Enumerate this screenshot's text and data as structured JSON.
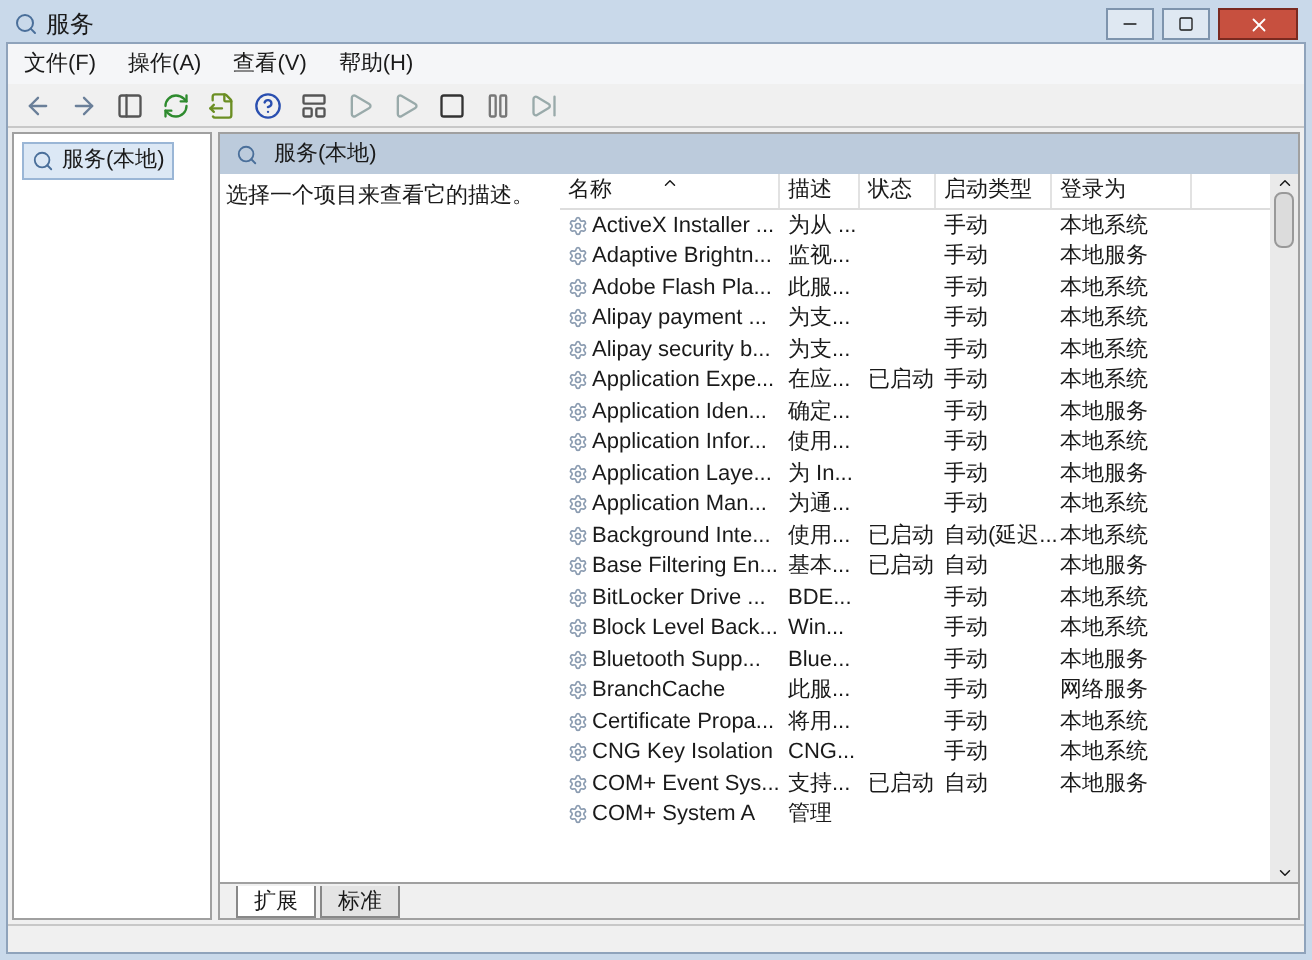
{
  "window": {
    "title": "服务"
  },
  "menu": [
    "文件(F)",
    "操作(A)",
    "查看(V)",
    "帮助(H)"
  ],
  "tree": {
    "items": [
      {
        "label": "服务(本地)",
        "selected": true
      }
    ]
  },
  "panel": {
    "title": "服务(本地)",
    "description": "选择一个项目来查看它的描述。"
  },
  "table": {
    "columns": [
      {
        "label": "名称",
        "sorted": true
      },
      {
        "label": "描述",
        "sorted": false
      },
      {
        "label": "状态",
        "sorted": false
      },
      {
        "label": "启动类型",
        "sorted": false
      },
      {
        "label": "登录为",
        "sorted": false
      }
    ],
    "rows": [
      {
        "name": "ActiveX Installer ...",
        "description": "为从 ...",
        "startup": "手动",
        "logon": "本地系统"
      },
      {
        "name": "Adaptive Brightn...",
        "description": "监视...",
        "startup": "手动",
        "logon": "本地服务"
      },
      {
        "name": "Adobe Flash Pla...",
        "description": "此服...",
        "startup": "手动",
        "logon": "本地系统"
      },
      {
        "name": "Alipay payment ...",
        "description": "为支...",
        "startup": "手动",
        "logon": "本地系统"
      },
      {
        "name": "Alipay security b...",
        "description": "为支...",
        "startup": "手动",
        "logon": "本地系统"
      },
      {
        "name": "Application Expe...",
        "description": "在应...",
        "status": "已启动",
        "startup": "手动",
        "logon": "本地系统"
      },
      {
        "name": "Application Iden...",
        "description": "确定...",
        "startup": "手动",
        "logon": "本地服务"
      },
      {
        "name": "Application Infor...",
        "description": "使用...",
        "startup": "手动",
        "logon": "本地系统"
      },
      {
        "name": "Application Laye...",
        "description": "为 In...",
        "startup": "手动",
        "logon": "本地服务"
      },
      {
        "name": "Application Man...",
        "description": "为通...",
        "startup": "手动",
        "logon": "本地系统"
      },
      {
        "name": "Background Inte...",
        "description": "使用...",
        "status": "已启动",
        "startup": "自动(延迟...",
        "logon": "本地系统"
      },
      {
        "name": "Base Filtering En...",
        "description": "基本...",
        "status": "已启动",
        "startup": "自动",
        "logon": "本地服务"
      },
      {
        "name": "BitLocker Drive ...",
        "description": "BDE...",
        "startup": "手动",
        "logon": "本地系统"
      },
      {
        "name": "Block Level Back...",
        "description": "Win...",
        "startup": "手动",
        "logon": "本地系统"
      },
      {
        "name": "Bluetooth Supp...",
        "description": "Blue...",
        "startup": "手动",
        "logon": "本地服务"
      },
      {
        "name": "BranchCache",
        "description": "此服...",
        "startup": "手动",
        "logon": "网络服务"
      },
      {
        "name": "Certificate Propa...",
        "description": "将用...",
        "startup": "手动",
        "logon": "本地系统"
      },
      {
        "name": "CNG Key Isolation",
        "description": "CNG...",
        "startup": "手动",
        "logon": "本地系统"
      },
      {
        "name": "COM+ Event Sys...",
        "description": "支持...",
        "status": "已启动",
        "startup": "自动",
        "logon": "本地服务"
      },
      {
        "name": "COM+ System A",
        "description": "管理"
      }
    ]
  },
  "tabs": [
    {
      "label": "扩展",
      "selected": true
    },
    {
      "label": "标准",
      "selected": false
    }
  ]
}
